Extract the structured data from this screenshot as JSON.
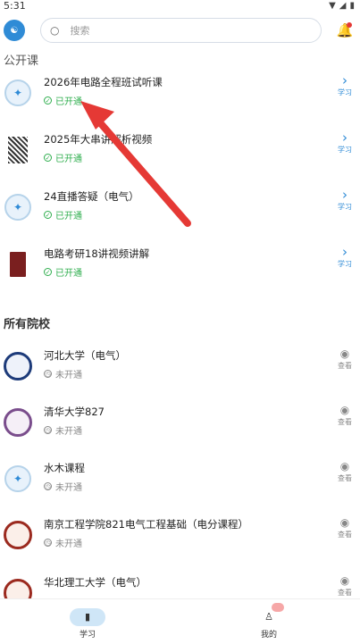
{
  "status_bar": {
    "time": "5:31"
  },
  "header": {
    "search_placeholder": "搜索"
  },
  "public_section": {
    "title": "公开课",
    "items": [
      {
        "title": "2026年电路全程班试听课",
        "status": "已开通",
        "action": "学习"
      },
      {
        "title": "2025年大串讲解析视频",
        "status": "已开通",
        "action": "学习"
      },
      {
        "title": "24直播答疑（电气）",
        "status": "已开通",
        "action": "学习"
      },
      {
        "title": "电路考研18讲视频讲解",
        "status": "已开通",
        "action": "学习"
      }
    ]
  },
  "schools_section": {
    "title": "所有院校",
    "items": [
      {
        "title": "河北大学（电气）",
        "status": "未开通",
        "action": "查看"
      },
      {
        "title": "清华大学827",
        "status": "未开通",
        "action": "查看"
      },
      {
        "title": "水木课程",
        "status": "未开通",
        "action": "查看"
      },
      {
        "title": "南京工程学院821电气工程基础（电分课程）",
        "status": "未开通",
        "action": "查看"
      },
      {
        "title": "华北理工大学（电气）",
        "status": "",
        "action": "查看"
      }
    ]
  },
  "bottom_nav": {
    "items": [
      {
        "label": "学习",
        "active": true
      },
      {
        "label": "我的",
        "active": false
      }
    ]
  },
  "colors": {
    "accent": "#2f8bd6",
    "open": "#2fae4e",
    "arrow": "#e53935"
  }
}
